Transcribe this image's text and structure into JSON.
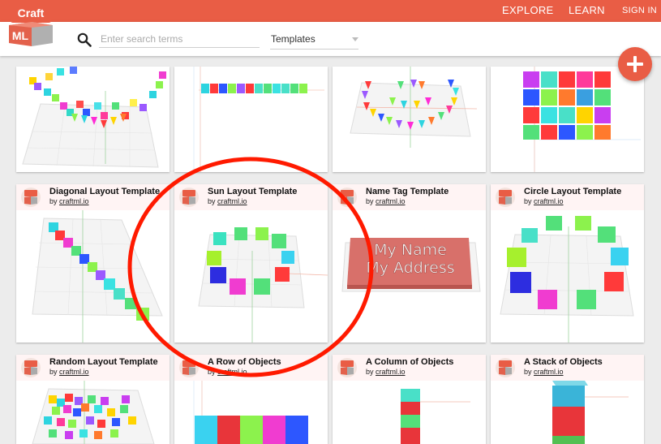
{
  "brand": {
    "logo_top": "Craft",
    "logo_bottom": "ML"
  },
  "nav": {
    "explore": "EXPLORE",
    "learn": "LEARN",
    "signin": "SIGN IN"
  },
  "search": {
    "placeholder": "Enter search terms",
    "value": ""
  },
  "filter": {
    "selected": "Templates"
  },
  "fab": {
    "icon": "plus-icon"
  },
  "by_prefix": "by",
  "cards": [
    {
      "title": "Diagonal Layout Template",
      "author": "craftml.io"
    },
    {
      "title": "Sun Layout Template",
      "author": "craftml.io"
    },
    {
      "title": "Name Tag Template",
      "author": "craftml.io"
    },
    {
      "title": "Circle Layout Template",
      "author": "craftml.io"
    },
    {
      "title": "Random Layout Template",
      "author": "craftml.io"
    },
    {
      "title": "A Row of Objects",
      "author": "craftml.io"
    },
    {
      "title": "A Column of Objects",
      "author": "craftml.io"
    },
    {
      "title": "A Stack of Objects",
      "author": "craftml.io"
    }
  ],
  "nametag": {
    "line1": "My Name",
    "line2": "My Address"
  },
  "colors": {
    "brand": "#e95d45",
    "annotation": "#ff1a00"
  }
}
